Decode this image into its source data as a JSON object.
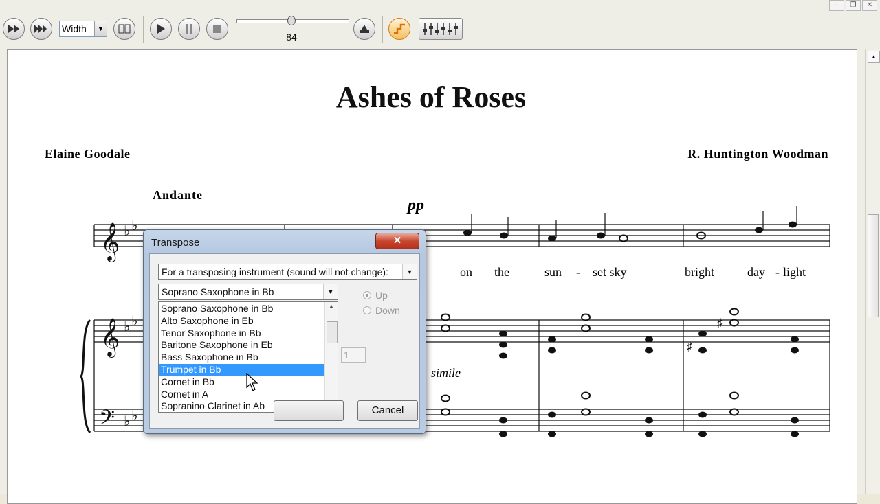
{
  "toolbar": {
    "zoom_value": "Width",
    "tempo_value": "84",
    "tempo_fraction": 0.48,
    "icons": [
      "fast-forward-icon",
      "skip-forward-icon",
      "view-mode-icon",
      "play-icon",
      "pause-icon",
      "stop-icon",
      "metronome-icon",
      "transpose-icon",
      "mixer-icon"
    ]
  },
  "window_controls": {
    "minimize": "–",
    "restore": "❐",
    "close": "✕"
  },
  "score": {
    "title": "Ashes of Roses",
    "lyricist": "Elaine Goodale",
    "composer": "R. Huntington Woodman",
    "tempo_marking": "Andante",
    "dynamic": "pp",
    "expression": "simile",
    "lyrics": [
      "on",
      "the",
      "sun",
      "-",
      "set sky",
      "bright",
      "day",
      "-",
      "light"
    ]
  },
  "dialog": {
    "title": "Transpose",
    "close_label": "✕",
    "mode": "For a transposing instrument (sound will not change):",
    "instrument_selected": "Soprano Saxophone in Bb",
    "instruments": [
      "Soprano Saxophone in Bb",
      "Alto Saxophone in Eb",
      "Tenor Saxophone in Bb",
      "Baritone Saxophone in Eb",
      "Bass Saxophone in Bb",
      "Trumpet in Bb",
      "Cornet in Bb",
      "Cornet in A",
      "Sopranino Clarinet in Ab"
    ],
    "highlighted_index": 5,
    "direction": {
      "up": "Up",
      "down": "Down",
      "selected": "up"
    },
    "interval_value": "1",
    "cancel_label": "Cancel"
  },
  "colors": {
    "selection": "#3399ff",
    "dialog_frame": "#b9cbe2",
    "close_button": "#c8472f"
  }
}
